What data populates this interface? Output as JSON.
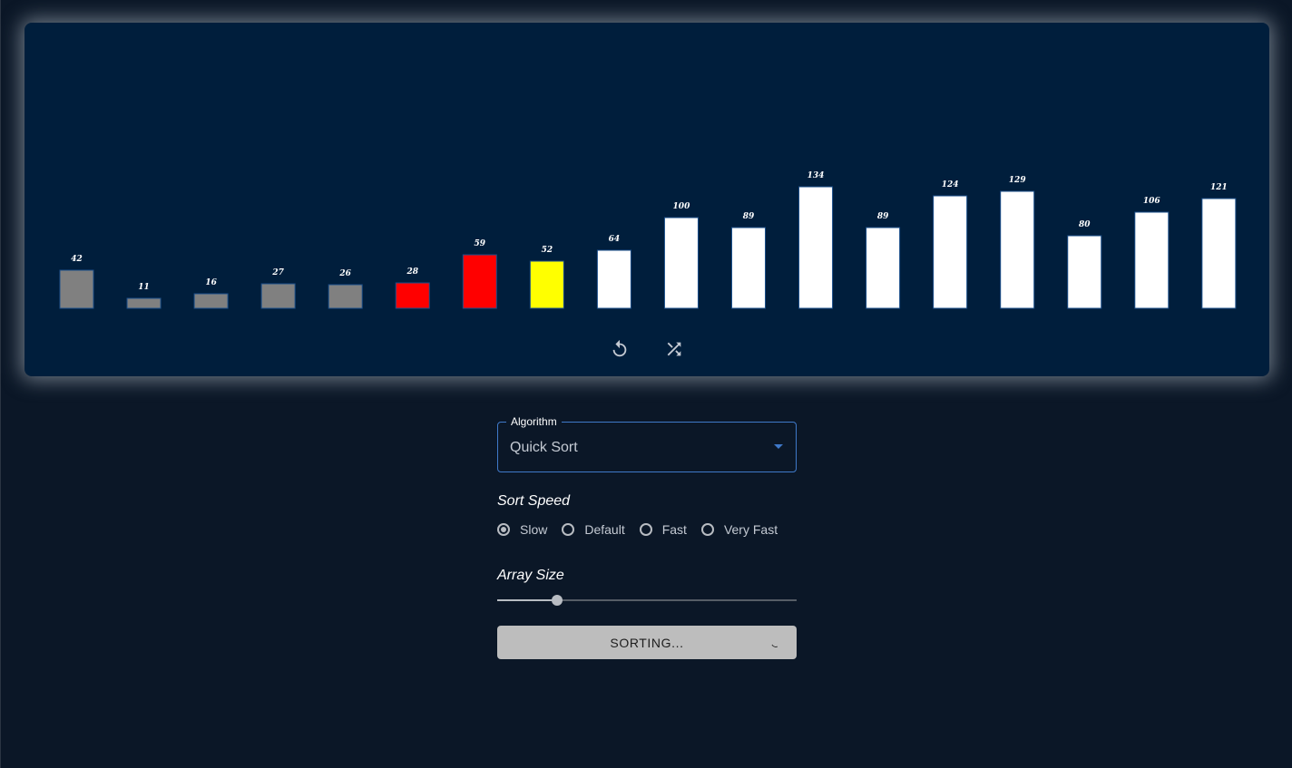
{
  "chart_data": {
    "type": "bar",
    "values": [
      42,
      11,
      16,
      27,
      26,
      28,
      59,
      52,
      64,
      100,
      89,
      134,
      89,
      124,
      129,
      80,
      106,
      121
    ],
    "states": [
      "sorted",
      "sorted",
      "sorted",
      "sorted",
      "sorted",
      "pivot",
      "pivot",
      "compare",
      "unsorted",
      "unsorted",
      "unsorted",
      "unsorted",
      "unsorted",
      "unsorted",
      "unsorted",
      "unsorted",
      "unsorted",
      "unsorted"
    ]
  },
  "colors": {
    "sorted": "#808080",
    "pivot": "#ff0000",
    "compare": "#ffff00",
    "unsorted": "#ffffff",
    "panel": "#001e3c",
    "accent": "#3f79c9"
  },
  "panel": {
    "reset_icon": "reset-icon",
    "shuffle_icon": "shuffle-icon"
  },
  "algorithm": {
    "label": "Algorithm",
    "value": "Quick Sort"
  },
  "speed": {
    "title": "Sort Speed",
    "options": [
      "Slow",
      "Default",
      "Fast",
      "Very Fast"
    ],
    "selected": "Slow"
  },
  "array_size": {
    "title": "Array Size",
    "fraction": 0.2
  },
  "action": {
    "label": "SORTING..."
  }
}
